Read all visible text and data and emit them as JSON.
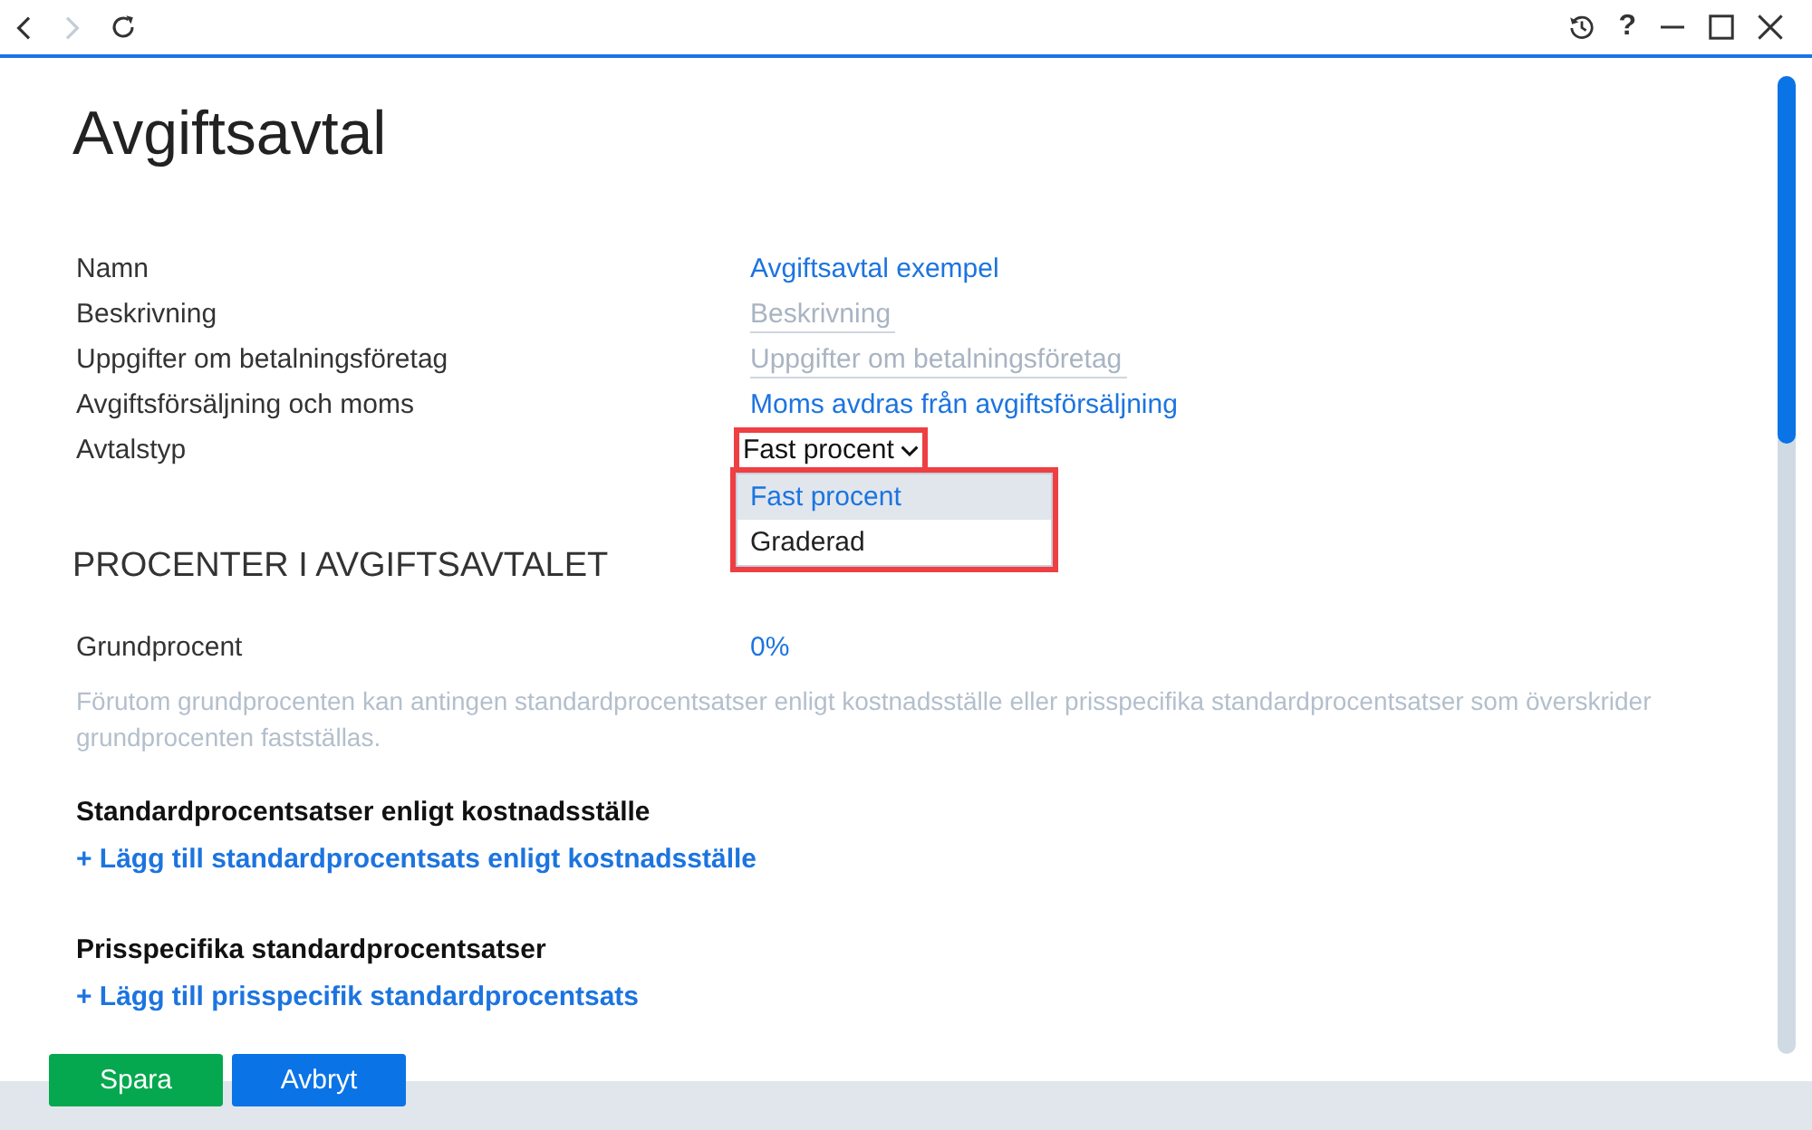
{
  "toolbar": {
    "nav_buttons": [
      {
        "kind": "back",
        "disabled": false
      },
      {
        "kind": "forward",
        "disabled": true
      },
      {
        "kind": "refresh",
        "disabled": false
      }
    ],
    "window_controls": [
      {
        "kind": "history"
      },
      {
        "kind": "help",
        "label": "?"
      },
      {
        "kind": "minimize"
      },
      {
        "kind": "maximize"
      },
      {
        "kind": "close"
      }
    ]
  },
  "page": {
    "title": "Avgiftsavtal",
    "fields": [
      {
        "label": "Namn",
        "kind": "link",
        "value": "Avgiftsavtal exempel"
      },
      {
        "label": "Beskrivning",
        "kind": "input",
        "placeholder": "Beskrivning"
      },
      {
        "label": "Uppgifter om betalningsföretag",
        "kind": "input",
        "placeholder": "Uppgifter om betalningsföretag"
      },
      {
        "label": "Avgiftsförsäljning och moms",
        "kind": "link",
        "value": "Moms avdras från avgiftsförsäljning"
      },
      {
        "label": "Avtalstyp",
        "kind": "select",
        "value": "Fast procent",
        "expanded": true,
        "highlighted": true,
        "menu_highlighted": true,
        "options": [
          {
            "label": "Fast procent",
            "selected": true
          },
          {
            "label": "Graderad",
            "selected": false
          }
        ]
      }
    ],
    "section": {
      "heading": "PROCENTER I AVGIFTSAVTALET",
      "fields": [
        {
          "label": "Grundprocent",
          "kind": "link",
          "value": "0%"
        }
      ],
      "help_text": "Förutom grundprocenten kan antingen standardprocentsatser enligt kostnadsställe eller prisspecifika standardprocentsatser som överskrider grundprocenten fastställas.",
      "groups": [
        {
          "heading": "Standardprocentsatser enligt kostnadsställe",
          "add_link": "+ Lägg till standardprocentsats enligt kostnadsställe"
        },
        {
          "heading": "Prisspecifika standardprocentsatser",
          "add_link": "+ Lägg till prisspecifik standardprocentsats"
        }
      ]
    }
  },
  "footer": {
    "buttons": [
      {
        "label": "Spara",
        "kind": "success"
      },
      {
        "label": "Avbryt",
        "kind": "primary"
      }
    ]
  }
}
